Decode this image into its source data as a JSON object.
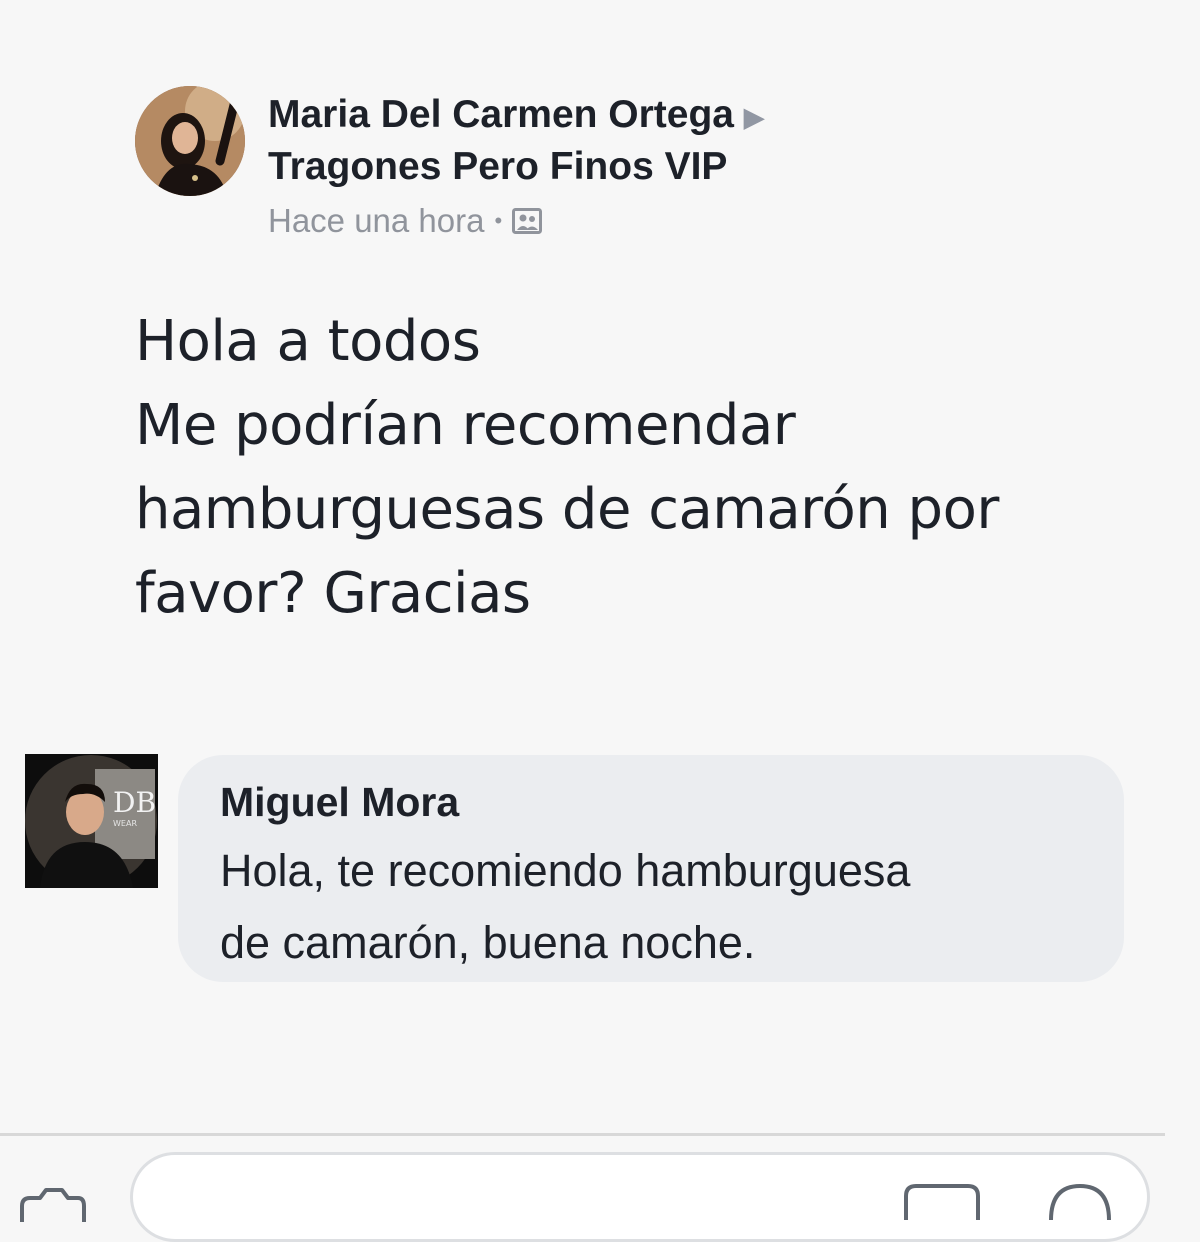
{
  "post": {
    "author": "Maria Del Carmen Ortega",
    "group": "Tragones Pero Finos VIP",
    "timestamp": "Hace una hora",
    "separator": "•",
    "privacy_icon": "photo-icon",
    "body_lines": [
      "Hola a todos",
      "Me podrían recomendar",
      "hamburguesas de camarón por",
      "favor? Gracias"
    ]
  },
  "comment": {
    "author": "Miguel Mora",
    "text_lines": [
      "Hola, te recomiendo hamburguesa",
      "de camarón, buena noche."
    ]
  },
  "composer": {
    "icons": [
      "camera-icon",
      "gif-icon",
      "emoji-icon"
    ]
  },
  "colors": {
    "background": "#f7f7f7",
    "bubble": "#ebedf0",
    "text": "#1d2129",
    "meta": "#90949c"
  }
}
